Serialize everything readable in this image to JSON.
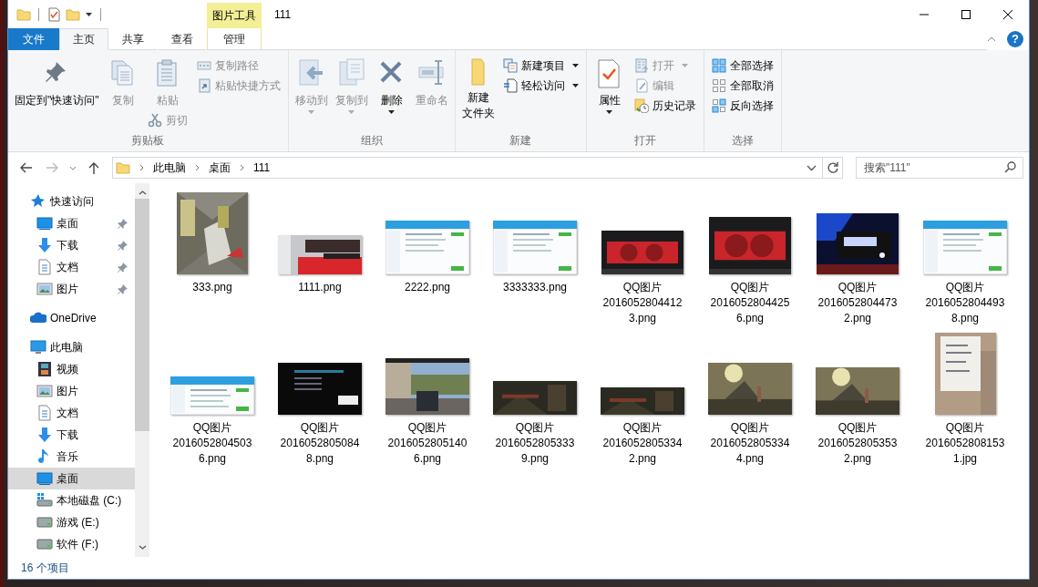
{
  "window": {
    "title": "111",
    "context_tab": "图片工具",
    "help": "?"
  },
  "tabs": [
    {
      "label": "文件",
      "kind": "file",
      "selected": false
    },
    {
      "label": "主页",
      "kind": "normal",
      "selected": true
    },
    {
      "label": "共享",
      "kind": "normal",
      "selected": false
    },
    {
      "label": "查看",
      "kind": "normal",
      "selected": false
    },
    {
      "label": "管理",
      "kind": "context",
      "selected": false
    }
  ],
  "ribbon": [
    {
      "label": "剪贴板",
      "columns": [
        {
          "kind": "large",
          "label": "固定到\"快速访问\"",
          "disabled": false,
          "dropdown": false
        },
        {
          "kind": "large",
          "label": "复制",
          "disabled": true,
          "dropdown": false
        },
        {
          "kind": "large",
          "label": "粘贴",
          "disabled": true,
          "dropdown": false,
          "below": {
            "label": "剪切",
            "disabled": true
          }
        },
        {
          "kind": "stack",
          "items": [
            {
              "label": "复制路径",
              "disabled": true,
              "dropdown": false
            },
            {
              "label": "粘贴快捷方式",
              "disabled": true,
              "dropdown": false
            }
          ]
        }
      ]
    },
    {
      "label": "组织",
      "columns": [
        {
          "kind": "large",
          "label": "移动到",
          "disabled": true,
          "dropdown": true
        },
        {
          "kind": "large",
          "label": "复制到",
          "disabled": true,
          "dropdown": true
        },
        {
          "kind": "large",
          "label": "删除",
          "disabled": false,
          "dropdown": true
        },
        {
          "kind": "large",
          "label": "重命名",
          "disabled": true,
          "dropdown": false
        }
      ]
    },
    {
      "label": "新建",
      "columns": [
        {
          "kind": "large",
          "label": "新建文件夹",
          "wrap": true,
          "disabled": false,
          "dropdown": false
        },
        {
          "kind": "stack",
          "items": [
            {
              "label": "新建项目",
              "disabled": false,
              "dropdown": true
            },
            {
              "label": "轻松访问",
              "disabled": false,
              "dropdown": true
            }
          ]
        }
      ]
    },
    {
      "label": "打开",
      "columns": [
        {
          "kind": "large",
          "label": "属性",
          "disabled": false,
          "dropdown": true
        },
        {
          "kind": "stack",
          "items": [
            {
              "label": "打开",
              "disabled": true,
              "dropdown": true
            },
            {
              "label": "编辑",
              "disabled": true,
              "dropdown": false
            },
            {
              "label": "历史记录",
              "disabled": false,
              "dropdown": false
            }
          ]
        }
      ]
    },
    {
      "label": "选择",
      "columns": [
        {
          "kind": "stack",
          "items": [
            {
              "label": "全部选择",
              "disabled": false,
              "dropdown": false
            },
            {
              "label": "全部取消",
              "disabled": false,
              "dropdown": false
            },
            {
              "label": "反向选择",
              "disabled": false,
              "dropdown": false
            }
          ]
        }
      ]
    }
  ],
  "address": {
    "path": [
      "此电脑",
      "桌面",
      "111"
    ],
    "search_placeholder": "搜索\"111\""
  },
  "sidebar": {
    "items": [
      {
        "label": "快速访问",
        "selected": false,
        "children": [
          {
            "label": "桌面",
            "selected": false,
            "pinned": true
          },
          {
            "label": "下载",
            "selected": false,
            "pinned": true
          },
          {
            "label": "文档",
            "selected": false,
            "pinned": true
          },
          {
            "label": "图片",
            "selected": false,
            "pinned": true
          }
        ]
      },
      {
        "label": "OneDrive",
        "selected": false
      },
      {
        "label": "此电脑",
        "selected": false,
        "children": [
          {
            "label": "视频",
            "selected": false
          },
          {
            "label": "图片",
            "selected": false
          },
          {
            "label": "文档",
            "selected": false
          },
          {
            "label": "下载",
            "selected": false
          },
          {
            "label": "音乐",
            "selected": false
          },
          {
            "label": "桌面",
            "selected": true
          },
          {
            "label": "本地磁盘 (C:)",
            "selected": false
          },
          {
            "label": "游戏 (E:)",
            "selected": false
          },
          {
            "label": "软件 (F:)",
            "selected": false
          }
        ]
      }
    ]
  },
  "files": [
    {
      "name": "333.png",
      "kind": "picture"
    },
    {
      "name": "1111.png",
      "kind": "picture"
    },
    {
      "name": "2222.png",
      "kind": "picture"
    },
    {
      "name": "3333333.png",
      "kind": "picture"
    },
    {
      "name": "QQ图片20160528044123.png",
      "kind": "picture"
    },
    {
      "name": "QQ图片20160528044256.png",
      "kind": "picture"
    },
    {
      "name": "QQ图片20160528044732.png",
      "kind": "picture"
    },
    {
      "name": "QQ图片20160528044938.png",
      "kind": "picture"
    },
    {
      "name": "QQ图片20160528045036.png",
      "kind": "picture"
    },
    {
      "name": "QQ图片20160528050848.png",
      "kind": "picture"
    },
    {
      "name": "QQ图片20160528051406.png",
      "kind": "picture"
    },
    {
      "name": "QQ图片20160528053339.png",
      "kind": "picture"
    },
    {
      "name": "QQ图片20160528053342.png",
      "kind": "picture"
    },
    {
      "name": "QQ图片20160528053344.png",
      "kind": "picture"
    },
    {
      "name": "QQ图片20160528053532.png",
      "kind": "picture"
    },
    {
      "name": "QQ图片20160528081531.jpg",
      "kind": "picture"
    }
  ],
  "status_bar": {
    "count": "16 个项目"
  }
}
